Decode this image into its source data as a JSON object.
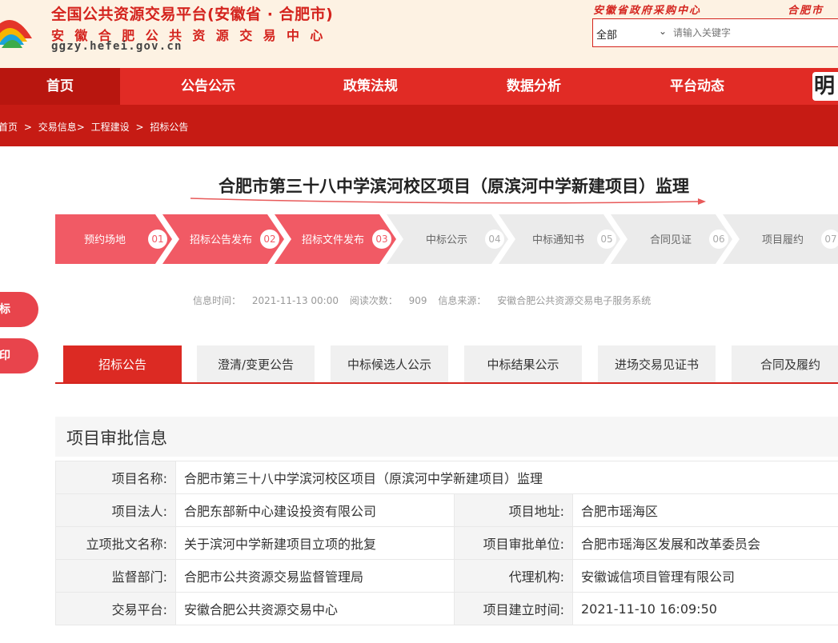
{
  "header": {
    "title": "全国公共资源交易平台(安徽省 · 合肥市)",
    "subtitle": "安徽合肥公共资源交易中心",
    "url": "ggzy.hefei.gov.cn",
    "top_link_1": "安徽省政府采购中心",
    "top_link_2": "合肥市",
    "search": {
      "select_value": "全部",
      "placeholder": "请输入关键字"
    }
  },
  "nav": {
    "items": [
      "首页",
      "公告公示",
      "政策法规",
      "数据分析",
      "平台动态"
    ],
    "banner_glyph": "明"
  },
  "breadcrumb": [
    "首页",
    ">",
    "交易信息>",
    "工程建设",
    ">",
    "招标公告"
  ],
  "page_title": "合肥市第三十八中学滨河校区项目（原滨河中学新建项目）监理",
  "steps": [
    {
      "label": "预约场地",
      "num": "01",
      "done": true
    },
    {
      "label": "招标公告发布",
      "num": "02",
      "done": true
    },
    {
      "label": "招标文件发布",
      "num": "03",
      "done": true
    },
    {
      "label": "中标公示",
      "num": "04",
      "done": false
    },
    {
      "label": "中标通知书",
      "num": "05",
      "done": false
    },
    {
      "label": "合同见证",
      "num": "06",
      "done": false
    },
    {
      "label": "项目履约",
      "num": "07",
      "done": false
    }
  ],
  "meta": {
    "time_label": "信息时间：",
    "time_value": "2021-11-13 00:00",
    "views_label": "阅读次数：",
    "views_value": "909",
    "source_label": "信息来源：",
    "source_value": "安徽合肥公共资源交易电子服务系统"
  },
  "side_buttons": [
    "投标",
    "打印"
  ],
  "tabs": [
    "招标公告",
    "澄清/变更公告",
    "中标候选人公示",
    "中标结果公示",
    "进场交易见证书",
    "合同及履约"
  ],
  "section_title": "项目审批信息",
  "info": {
    "name_label": "项目名称:",
    "name_value": "合肥市第三十八中学滨河校区项目（原滨河中学新建项目）监理",
    "legal_label": "项目法人:",
    "legal_value": "合肥东部新中心建设投资有限公司",
    "address_label": "项目地址:",
    "address_value": "合肥市瑶海区",
    "approval_doc_label": "立项批文名称:",
    "approval_doc_value": "关于滨河中学新建项目立项的批复",
    "approval_unit_label": "项目审批单位:",
    "approval_unit_value": "合肥市瑶海区发展和改革委员会",
    "supervision_label": "监督部门:",
    "supervision_value": "合肥市公共资源交易监督管理局",
    "agency_label": "代理机构:",
    "agency_value": "安徽诚信项目管理有限公司",
    "platform_label": "交易平台:",
    "platform_value": "安徽合肥公共资源交易中心",
    "created_label": "项目建立时间:",
    "created_value": "2021-11-10 16:09:50"
  },
  "colors": {
    "brand_red": "#e12b25",
    "dark_red": "#b8160f",
    "step_done": "#f15a65",
    "step_todo": "#ebebeb"
  }
}
